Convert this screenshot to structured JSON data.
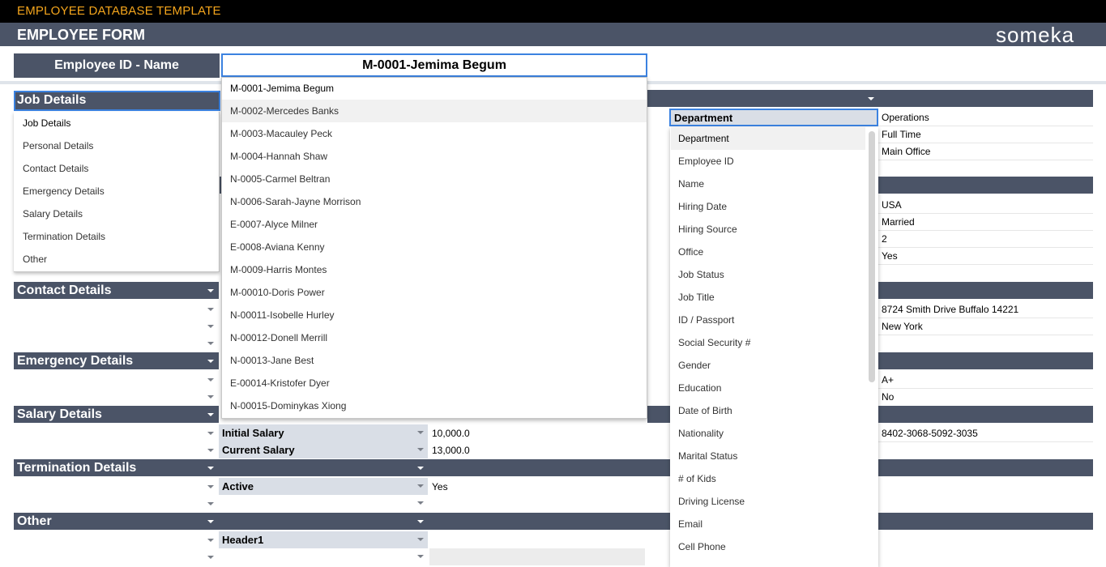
{
  "app": {
    "top_title": "EMPLOYEE DATABASE TEMPLATE",
    "form_title": "EMPLOYEE FORM",
    "logo": "someka"
  },
  "employee": {
    "id_label": "Employee ID - Name",
    "selected": "M-0001-Jemima Begum",
    "options": [
      "M-0001-Jemima Begum",
      "M-0002-Mercedes Banks",
      "M-0003-Macauley Peck",
      "M-0004-Hannah Shaw",
      "N-0005-Carmel Beltran",
      "N-0006-Sarah-Jayne Morrison",
      "E-0007-Alyce Milner",
      "E-0008-Aviana Kenny",
      "M-0009-Harris Montes",
      "M-00010-Doris Power",
      "N-00011-Isobelle Hurley",
      "N-00012-Donell Merrill",
      "N-00013-Jane Best",
      "E-00014-Kristofer Dyer",
      "N-00015-Dominykas Xiong"
    ]
  },
  "sections": {
    "selected": "Job Details",
    "options": [
      "Job Details",
      "Personal Details",
      "Contact Details",
      "Emergency Details",
      "Salary Details",
      "Termination Details",
      "Other"
    ],
    "contact": "Contact Details",
    "emergency": "Emergency Details",
    "salary": "Salary Details",
    "termination": "Termination Details",
    "other": "Other"
  },
  "fields": {
    "selected": "Department",
    "options": [
      "Department",
      "Employee ID",
      "Name",
      "Hiring Date",
      "Hiring Source",
      "Office",
      "Job Status",
      "Job Title",
      "ID / Passport",
      "Social Security #",
      "Gender",
      "Education",
      "Date of Birth",
      "Nationality",
      "Marital Status",
      "# of Kids",
      "Driving License",
      "Email",
      "Cell Phone"
    ]
  },
  "right_values": {
    "job": [
      "Operations",
      "Full Time",
      "Main Office"
    ],
    "personal": [
      "USA",
      "Married",
      "2",
      "Yes"
    ],
    "contact": [
      "8724 Smith Drive Buffalo 14221",
      "New York"
    ],
    "emergency": [
      "A+",
      "No"
    ],
    "salary": [
      "8402-3068-5092-3035"
    ]
  },
  "salary": {
    "initial_label": "Initial Salary",
    "initial_value": "10,000.0",
    "current_label": "Current Salary",
    "current_value": "13,000.0"
  },
  "termination": {
    "active_label": "Active",
    "active_value": "Yes"
  },
  "other": {
    "header_label": "Header1"
  },
  "colors": {
    "header": "#4b5467",
    "accent_title": "#f4a51c",
    "focus_border": "#3b82e0",
    "label_bg": "#d9dee6"
  }
}
